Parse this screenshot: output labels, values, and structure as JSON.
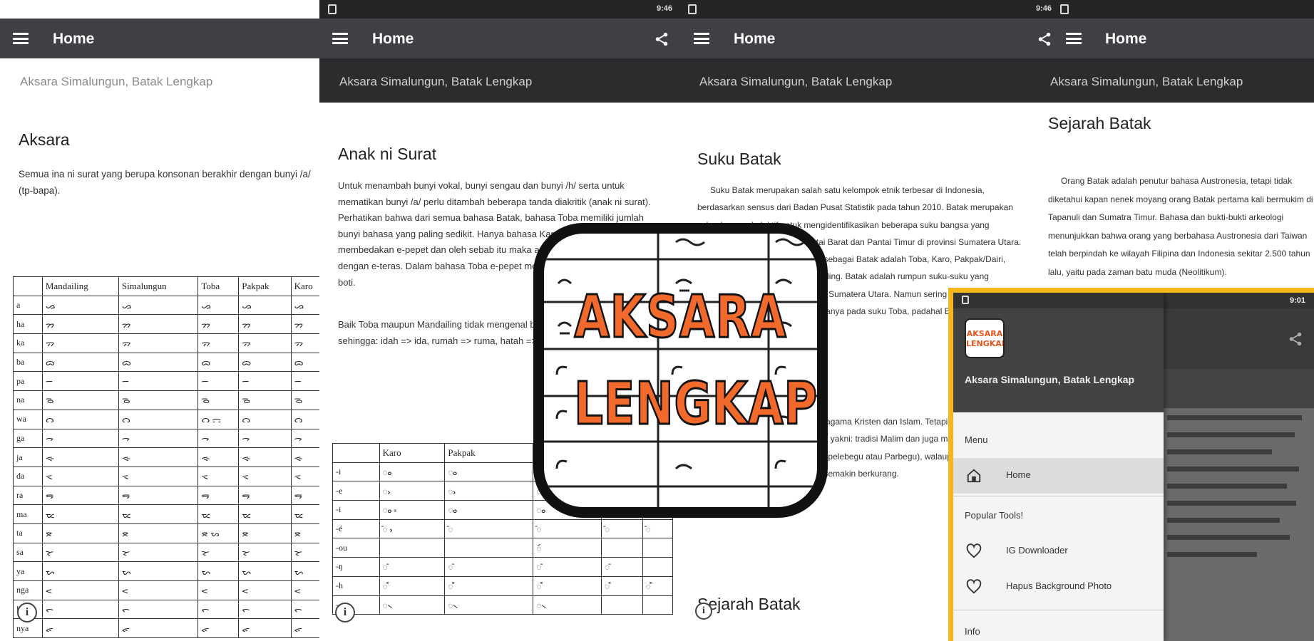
{
  "app_name": "Aksara Simalungun, Batak Lengkap",
  "colors": {
    "appbar": "#3e4043",
    "statusbar": "#242526",
    "logo_text": "#f26a2b",
    "drawer_highlight": "#f6b71c"
  },
  "icons": [
    "menu-icon",
    "share-icon",
    "info-icon",
    "home-icon",
    "heart-icon",
    "battery-icon"
  ],
  "panel1": {
    "title": "Home",
    "subtitle": "Aksara Simalungun, Batak Lengkap",
    "heading": "Aksara",
    "paragraph": "Semua ina ni surat yang berupa konsonan berakhir dengan bunyi /a/ (tp-bapa).",
    "table_header": [
      "",
      "Mandailing",
      "Simalungun",
      "Toba",
      "Pakpak",
      "Karo"
    ],
    "table_rows": [
      [
        "a",
        "ᯀ",
        "ᯀ",
        "ᯀ",
        "ᯀ",
        "ᯀ"
      ],
      [
        "ha",
        "ᯂ",
        "ᯂ",
        "ᯂ",
        "ᯂ",
        "ᯂ"
      ],
      [
        "ka",
        "ᯄ",
        "ᯄ",
        "ᯄ",
        "ᯄ",
        "ᯄ"
      ],
      [
        "ba",
        "ᯅ",
        "ᯅ",
        "ᯅ",
        "ᯅ",
        "ᯅ"
      ],
      [
        "pa",
        "ᯇ",
        "ᯇ",
        "ᯇ",
        "ᯇ",
        "ᯇ"
      ],
      [
        "na",
        "ᯉ",
        "ᯉ",
        "ᯉ",
        "ᯉ",
        "ᯉ"
      ],
      [
        "wa",
        "ᯋ",
        "ᯋ",
        "ᯋ ᯌ",
        "ᯋ",
        "ᯋ"
      ],
      [
        "ga",
        "ᯎ",
        "ᯎ",
        "ᯎ",
        "ᯎ",
        "ᯎ"
      ],
      [
        "ja",
        "ᯐ",
        "ᯐ",
        "ᯐ",
        "ᯐ",
        "ᯐ"
      ],
      [
        "da",
        "ᯑ",
        "ᯑ",
        "ᯑ",
        "ᯑ",
        "ᯑ"
      ],
      [
        "ra",
        "ᯒ",
        "ᯒ",
        "ᯒ",
        "ᯒ",
        "ᯒ"
      ],
      [
        "ma",
        "ᯔ",
        "ᯔ",
        "ᯔ",
        "ᯔ",
        "ᯔ"
      ],
      [
        "ta",
        "ᯖ",
        "ᯖ",
        "ᯖ ᯗ",
        "ᯖ",
        "ᯖ"
      ],
      [
        "sa",
        "ᯘ",
        "ᯘ",
        "ᯘ",
        "ᯘ",
        "ᯘ"
      ],
      [
        "ya",
        "ᯛ",
        "ᯛ",
        "ᯛ",
        "ᯛ",
        "ᯛ"
      ],
      [
        "nga",
        "ᯝ",
        "ᯝ",
        "ᯝ",
        "ᯝ",
        "ᯝ"
      ],
      [
        "la",
        "ᯞ",
        "ᯞ",
        "ᯞ",
        "ᯞ",
        "ᯞ"
      ],
      [
        "nya",
        "ᯠ",
        "ᯠ",
        "ᯠ",
        "ᯠ",
        "ᯠ"
      ]
    ]
  },
  "panel2": {
    "title": "Home",
    "subtitle": "Aksara Simalungun, Batak Lengkap",
    "heading": "Anak ni Surat",
    "paragraph1": "Untuk menambah bunyi vokal, bunyi sengau dan bunyi /h/ serta untuk mematikan bunyi /a/ perlu ditambah beberapa tanda diakritik (anak ni surat). Perhatikan bahwa dari semua bahasa Batak, bahasa Toba memiliki jumlah bunyi bahasa yang paling sedikit. Hanya bahasa Karo dan Pakpak yang membedakan e-pepet dan oleh sebab itu maka ada huruf e yang berbeda dengan e-teras. Dalam bahasa Toba e-pepet menjadi /o/: kola => kola, besi => boti.",
    "paragraph2": "Baik Toba maupun Mandailing tidak mengenal bunyi h diakhir suku kata sehingga: idah => ida, rumah => ruma, hatah => hata.",
    "table_header": [
      "",
      "Karo",
      "Pakpak",
      "Surat",
      "",
      ""
    ],
    "table_rows": [
      [
        "-i",
        "ᯪ",
        "ᯪ",
        "",
        "",
        ""
      ],
      [
        "-e",
        "ᯧ",
        "ᯧ",
        "ᯧ",
        "",
        ""
      ],
      [
        "-i",
        "ᯪ ᯫ",
        "ᯪ",
        "ᯪ",
        "ᯪ",
        ""
      ],
      [
        "-é",
        "ᯩ ᯧ",
        "ᯩ",
        "ᯩ",
        "ᯩ",
        "ᯩ"
      ],
      [
        "-ou",
        "",
        "",
        "ᯯ",
        "",
        ""
      ],
      [
        "-ŋ",
        "ᯰ",
        "ᯰ",
        "ᯰ",
        "ᯰ",
        ""
      ],
      [
        "-h",
        "ᯱ",
        "ᯱ",
        "ᯱ",
        "ᯱ",
        "ᯱ"
      ],
      [
        "-",
        "᯲",
        "᯲",
        "᯲",
        "",
        ""
      ]
    ]
  },
  "panel3": {
    "title": "Home",
    "subtitle": "Aksara Simalungun, Batak Lengkap",
    "heading": "Suku Batak",
    "paragraph": "Suku Batak merupakan salah satu kelompok etnik terbesar di Indonesia, berdasarkan sensus dari Badan Pusat Statistik pada tahun 2010. Batak merupakan sebuah nama kolektif untuk mengidentifikasikan beberapa suku bangsa yang bermukim dan berasal dari Pantai Barat dan Pantai Timur di provinsi Sumatera Utara. Suku bangsa yang dikategorikan sebagai Batak adalah Toba, Karo, Pakpak/Dairi, Simalungun, Angkola, dan Mandailing. Batak adalah rumpun suku-suku yang mendiami sebagian besar wilayah Sumatera Utara. Namun sering sekali orang menganggap penyebutan Batak hanya pada suku Toba, padahal Batak tidak hanya diwakili oleh suku Toba.",
    "paragraph2": "Mayoritas orang Batak menganut agama Kristen dan Islam. Tetapi dan ada pula yang menganut kepercayaan tradisional yakni: tradisi Malim dan juga menganut kepercayaan animisme (disebut Sipelebegu atau Parbegu), walaupun kini jumlah penganut kedua ajaran ini sudah semakin berkurang.",
    "heading2": "Sejarah Batak"
  },
  "panel4": {
    "title": "Home",
    "subtitle": "Aksara Simalungun, Batak Lengkap",
    "heading": "Sejarah Batak",
    "paragraph": "Orang Batak adalah penutur bahasa Austronesia, tetapi tidak diketahui kapan nenek moyang orang Batak pertama kali bermukim di Tapanuli dan Sumatra Timur. Bahasa dan bukti-bukti arkeologi menunjukkan bahwa orang yang berbahasa Austronesia dari Taiwan telah berpindah ke wilayah Filipina dan Indonesia sekitar 2.500 tahun lalu, yaitu pada zaman batu muda (Neolitikum)."
  },
  "status": {
    "time1": "9:46",
    "time2": "9:46",
    "time3": "9:01"
  },
  "logo": {
    "line1": "AKSARA",
    "line2": "LENGKAP"
  },
  "drawer": {
    "title": "Aksara Simalungun, Batak Lengkap",
    "logo_text1": "AKSARA",
    "logo_text2": "LENGKAP",
    "section_menu": "Menu",
    "home_label": "Home",
    "section_popular": "Popular Tools!",
    "item1": "IG Downloader",
    "item2": "Hapus Background Photo",
    "section_info": "Info"
  }
}
